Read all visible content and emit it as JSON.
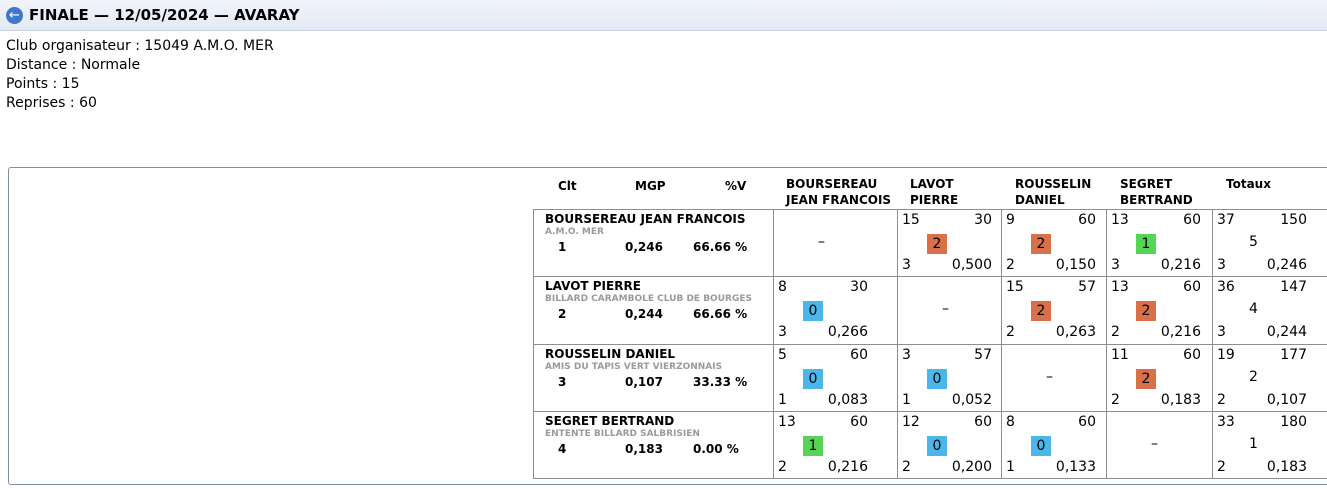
{
  "header": {
    "title": "FINALE — 12/05/2024 — AVARAY",
    "back_icon": "arrow-left-icon"
  },
  "info": {
    "club": "Club organisateur : 15049 A.M.O. MER",
    "distance": "Distance : Normale",
    "points": "Points : 15",
    "reprises": "Reprises : 60"
  },
  "table": {
    "col_clt": "Clt",
    "col_mgp": "MGP",
    "col_pv": "%V",
    "col_totaux": "Totaux",
    "opponents": [
      {
        "line1": "BOURSEREAU",
        "line2": "JEAN FRANCOIS"
      },
      {
        "line1": "LAVOT",
        "line2": "PIERRE"
      },
      {
        "line1": "ROUSSELIN",
        "line2": "DANIEL"
      },
      {
        "line1": "SEGRET",
        "line2": "BERTRAND"
      }
    ],
    "rows": [
      {
        "name": "BOURSEREAU JEAN FRANCOIS",
        "club": "A.M.O. MER",
        "rank": "1",
        "mgp": "0,246",
        "pv": "66.66 %",
        "cells": [
          {
            "dash": "–"
          },
          {
            "tl": "15",
            "tr": "30",
            "badge": "2",
            "kind": "w",
            "bl": "3",
            "br": "0,500"
          },
          {
            "tl": "9",
            "tr": "60",
            "badge": "2",
            "kind": "w",
            "bl": "2",
            "br": "0,150"
          },
          {
            "tl": "13",
            "tr": "60",
            "badge": "1",
            "kind": "d",
            "bl": "3",
            "br": "0,216"
          }
        ],
        "total": {
          "tl": "37",
          "tr": "150",
          "mid": "5",
          "bl": "3",
          "br": "0,246"
        }
      },
      {
        "name": "LAVOT PIERRE",
        "club": "BILLARD CARAMBOLE CLUB DE BOURGES",
        "rank": "2",
        "mgp": "0,244",
        "pv": "66.66 %",
        "cells": [
          {
            "tl": "8",
            "tr": "30",
            "badge": "0",
            "kind": "l",
            "bl": "3",
            "br": "0,266"
          },
          {
            "dash": "–"
          },
          {
            "tl": "15",
            "tr": "57",
            "badge": "2",
            "kind": "w",
            "bl": "2",
            "br": "0,263"
          },
          {
            "tl": "13",
            "tr": "60",
            "badge": "2",
            "kind": "w",
            "bl": "2",
            "br": "0,216"
          }
        ],
        "total": {
          "tl": "36",
          "tr": "147",
          "mid": "4",
          "bl": "3",
          "br": "0,244"
        }
      },
      {
        "name": "ROUSSELIN DANIEL",
        "club": "AMIS DU TAPIS VERT VIERZONNAIS",
        "rank": "3",
        "mgp": "0,107",
        "pv": "33.33 %",
        "cells": [
          {
            "tl": "5",
            "tr": "60",
            "badge": "0",
            "kind": "l",
            "bl": "1",
            "br": "0,083"
          },
          {
            "tl": "3",
            "tr": "57",
            "badge": "0",
            "kind": "l",
            "bl": "1",
            "br": "0,052"
          },
          {
            "dash": "–"
          },
          {
            "tl": "11",
            "tr": "60",
            "badge": "2",
            "kind": "w",
            "bl": "2",
            "br": "0,183"
          }
        ],
        "total": {
          "tl": "19",
          "tr": "177",
          "mid": "2",
          "bl": "2",
          "br": "0,107"
        }
      },
      {
        "name": "SEGRET BERTRAND",
        "club": "ENTENTE BILLARD SALBRISIEN",
        "rank": "4",
        "mgp": "0,183",
        "pv": "0.00 %",
        "cells": [
          {
            "tl": "13",
            "tr": "60",
            "badge": "1",
            "kind": "d",
            "bl": "2",
            "br": "0,216"
          },
          {
            "tl": "12",
            "tr": "60",
            "badge": "0",
            "kind": "l",
            "bl": "2",
            "br": "0,200"
          },
          {
            "tl": "8",
            "tr": "60",
            "badge": "0",
            "kind": "l",
            "bl": "1",
            "br": "0,133"
          },
          {
            "dash": "–"
          }
        ],
        "total": {
          "tl": "33",
          "tr": "180",
          "mid": "1",
          "bl": "2",
          "br": "0,183"
        }
      }
    ]
  },
  "colors": {
    "win": "#d8704a",
    "loss": "#4db6e8",
    "draw": "#55d455"
  }
}
